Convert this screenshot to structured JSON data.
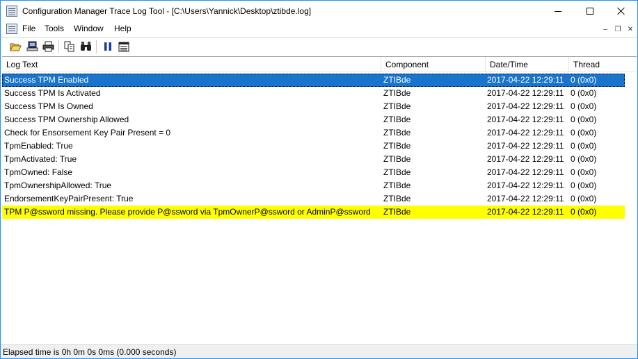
{
  "window": {
    "title": "Configuration Manager Trace Log Tool - [C:\\Users\\Yannick\\Desktop\\ztibde.log]",
    "accent_color": "#1e90ff"
  },
  "menu": {
    "items": [
      {
        "label": "File"
      },
      {
        "label": "Tools"
      },
      {
        "label": "Window"
      },
      {
        "label": "Help"
      }
    ]
  },
  "toolbar": {
    "buttons": [
      "open-icon",
      "open-on-server-icon",
      "print-icon",
      "copy-icon",
      "find-icon",
      "pause-icon",
      "highlight-icon"
    ]
  },
  "columns": [
    {
      "label": "Log Text"
    },
    {
      "label": "Component"
    },
    {
      "label": "Date/Time"
    },
    {
      "label": "Thread"
    }
  ],
  "rows": [
    {
      "text": "Success TPM Enabled",
      "component": "ZTIBde",
      "datetime": "2017-04-22 12:29:11",
      "thread": "0 (0x0)",
      "state": "selected"
    },
    {
      "text": "Success TPM Is Activated",
      "component": "ZTIBde",
      "datetime": "2017-04-22 12:29:11",
      "thread": "0 (0x0)",
      "state": "normal"
    },
    {
      "text": "Success TPM Is Owned",
      "component": "ZTIBde",
      "datetime": "2017-04-22 12:29:11",
      "thread": "0 (0x0)",
      "state": "normal"
    },
    {
      "text": "Success TPM Ownership Allowed",
      "component": "ZTIBde",
      "datetime": "2017-04-22 12:29:11",
      "thread": "0 (0x0)",
      "state": "normal"
    },
    {
      "text": "Check for Ensorsement Key Pair Present = 0",
      "component": "ZTIBde",
      "datetime": "2017-04-22 12:29:11",
      "thread": "0 (0x0)",
      "state": "normal"
    },
    {
      "text": "TpmEnabled: True",
      "component": "ZTIBde",
      "datetime": "2017-04-22 12:29:11",
      "thread": "0 (0x0)",
      "state": "normal"
    },
    {
      "text": "TpmActivated: True",
      "component": "ZTIBde",
      "datetime": "2017-04-22 12:29:11",
      "thread": "0 (0x0)",
      "state": "normal"
    },
    {
      "text": "TpmOwned: False",
      "component": "ZTIBde",
      "datetime": "2017-04-22 12:29:11",
      "thread": "0 (0x0)",
      "state": "normal"
    },
    {
      "text": "TpmOwnershipAllowed: True",
      "component": "ZTIBde",
      "datetime": "2017-04-22 12:29:11",
      "thread": "0 (0x0)",
      "state": "normal"
    },
    {
      "text": "EndorsementKeyPairPresent: True",
      "component": "ZTIBde",
      "datetime": "2017-04-22 12:29:11",
      "thread": "0 (0x0)",
      "state": "normal"
    },
    {
      "text": "TPM P@ssword missing. Please provide P@ssword via TpmOwnerP@ssword or AdminP@ssword",
      "component": "ZTIBde",
      "datetime": "2017-04-22 12:29:11",
      "thread": "0 (0x0)",
      "state": "warning"
    }
  ],
  "colors": {
    "selected_row": "#1874cd",
    "warning_row": "#ffff00"
  },
  "status": {
    "text": "Elapsed time is 0h 0m 0s 0ms (0.000 seconds)"
  }
}
